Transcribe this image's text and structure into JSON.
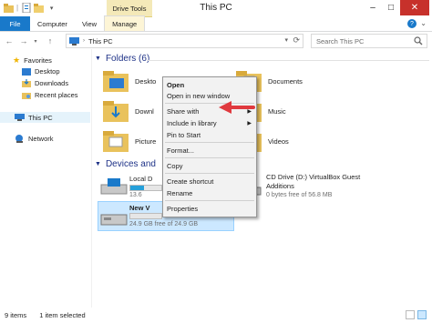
{
  "window": {
    "title": "This PC",
    "context_tab_group": "Drive Tools",
    "minimize": "–",
    "maximize": "□",
    "close": "✕"
  },
  "ribbon": {
    "tabs": [
      "File",
      "Computer",
      "View",
      "Manage"
    ],
    "help": "?",
    "toggle": "⌄"
  },
  "nav": {
    "back": "←",
    "forward": "→",
    "up": "↑",
    "address": "This PC",
    "search_placeholder": "Search This PC"
  },
  "sidebar": {
    "favorites": "Favorites",
    "items": [
      "Desktop",
      "Downloads",
      "Recent places"
    ],
    "this_pc": "This PC",
    "network": "Network"
  },
  "folders": {
    "header": "Folders (6)",
    "items": [
      "Deskto",
      "Downl",
      "Picture",
      "Documents",
      "Music",
      "Videos"
    ]
  },
  "devices": {
    "header": "Devices and",
    "drives": [
      {
        "name": "Local D",
        "free": "13.6",
        "used_fraction": 0.45
      },
      {
        "name": "New V",
        "free": "24.9 GB free of 24.9 GB",
        "used_fraction": 0.0
      },
      {
        "name": "CD Drive (D:) VirtualBox Guest",
        "name2": "Additions",
        "free": "0 bytes free of 56.8 MB",
        "used_fraction": 1.0
      }
    ]
  },
  "context_menu": {
    "items": [
      "Open",
      "Open in new window",
      "Share with",
      "Include in library",
      "Pin to Start",
      "Format...",
      "Copy",
      "Create shortcut",
      "Rename",
      "Properties"
    ]
  },
  "status": {
    "count": "9 items",
    "selected": "1 item selected"
  },
  "colors": {
    "accent": "#1979ca",
    "selection": "#cce8ff",
    "arrow": "#e0393e",
    "context_tab": "#f4e9b8"
  }
}
